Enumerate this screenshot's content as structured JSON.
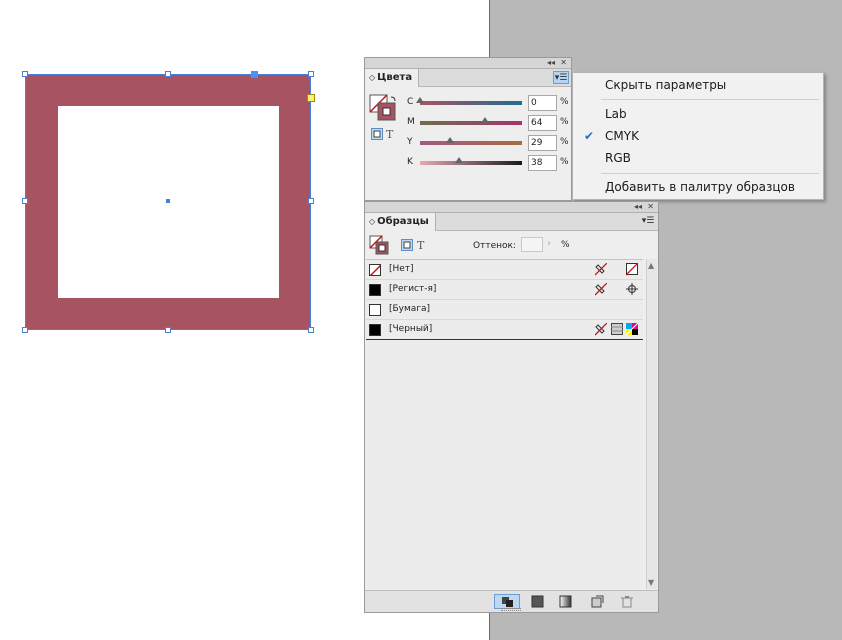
{
  "colors": {
    "fill": "#a75361",
    "selection": "#4a7ed8",
    "pasteboard": "#b8b8b8",
    "menu_highlight": "#b4d4f4"
  },
  "color_panel": {
    "tab_label": "Цвета",
    "collapse_icon": "double-chevron-left-icon",
    "close_icon": "close-icon",
    "menu_icon": "panel-menu-icon",
    "sliders": [
      {
        "label": "C",
        "value": "0",
        "unit": "%",
        "position": 0.0
      },
      {
        "label": "M",
        "value": "64",
        "unit": "%",
        "position": 0.64
      },
      {
        "label": "Y",
        "value": "29",
        "unit": "%",
        "position": 0.29
      },
      {
        "label": "K",
        "value": "38",
        "unit": "%",
        "position": 0.38
      }
    ]
  },
  "color_menu": {
    "items": [
      {
        "label": "Скрыть параметры",
        "checked": false
      },
      {
        "label": "Lab",
        "checked": false
      },
      {
        "label": "CMYK",
        "checked": true
      },
      {
        "label": "RGB",
        "checked": false
      },
      {
        "label": "Добавить в палитру образцов",
        "checked": false
      }
    ]
  },
  "swatches_panel": {
    "tab_label": "Образцы",
    "tint_label": "Оттенок:",
    "tint_value": "",
    "tint_unit": "%",
    "rows": [
      {
        "name": "[Нет]",
        "chip": "none",
        "icon1": "no-edit-icon",
        "icon2": "none-swatch-icon"
      },
      {
        "name": "[Регист-я]",
        "chip": "black",
        "icon1": "no-edit-icon",
        "icon2": "registration-icon"
      },
      {
        "name": "[Бумага]",
        "chip": "white",
        "icon1": "",
        "icon2": ""
      },
      {
        "name": "[Черный]",
        "chip": "black",
        "icon1": "no-edit-icon",
        "icon2": "process-cmyk-icon"
      }
    ],
    "footer_buttons": [
      "show-all-swatches-icon",
      "show-color-swatches-icon",
      "show-gradient-swatches-icon",
      "new-swatch-icon",
      "delete-swatch-icon"
    ]
  }
}
